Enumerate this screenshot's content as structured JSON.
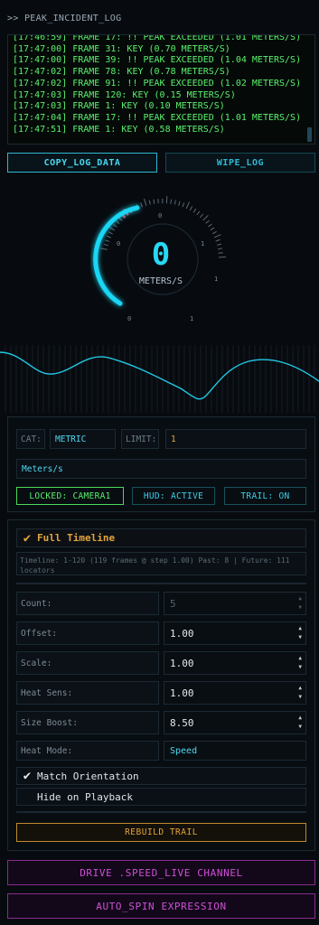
{
  "header": {
    "title": ">> PEAK_INCIDENT_LOG"
  },
  "log": {
    "lines": [
      "[17:46:59] FRAME 17: !! PEAK EXCEEDED (1.01 METERS/S)",
      "[17:47:00] FRAME 31: KEY (0.70 METERS/S)",
      "[17:47:00] FRAME 39: !! PEAK EXCEEDED (1.04 METERS/S)",
      "[17:47:02] FRAME 78: KEY (0.78 METERS/S)",
      "[17:47:02] FRAME 91: !! PEAK EXCEEDED (1.02 METERS/S)",
      "[17:47:03] FRAME 120: KEY (0.15 METERS/S)",
      "[17:47:03] FRAME 1: KEY (0.10 METERS/S)",
      "[17:47:04] FRAME 17: !! PEAK EXCEEDED (1.01 METERS/S)",
      "[17:47:51] FRAME 1: KEY (0.58 METERS/S)"
    ],
    "copy_label": "COPY_LOG_DATA",
    "wipe_label": "WIPE_LOG"
  },
  "gauge": {
    "value": "0",
    "unit": "METERS/S",
    "ticks": [
      "0",
      "0",
      "1",
      "1",
      "0",
      "1"
    ],
    "fill_fraction": 0.0,
    "colors": {
      "accent": "#1ad6f3",
      "peak": "#e0304a"
    }
  },
  "settings": {
    "cat_label": "CAT:",
    "cat_value": "METRIC",
    "limit_label": "LIMIT:",
    "limit_value": "1",
    "unit_value": "Meters/s",
    "locked": "LOCKED: CAMERA1",
    "hud": "HUD: ACTIVE",
    "trail": "TRAIL: ON"
  },
  "timeline": {
    "full_label": "Full Timeline",
    "full_checked": true,
    "info": "Timeline: 1-120  (119 frames @ step 1.00)  Past: 8 | Future: 111 locators",
    "rows": [
      {
        "label": "Count:",
        "value": "5",
        "disabled": true
      },
      {
        "label": "Offset:",
        "value": "1.00"
      },
      {
        "label": "Scale:",
        "value": "1.00"
      },
      {
        "label": "Heat Sens:",
        "value": "1.00"
      },
      {
        "label": "Size Boost:",
        "value": "8.50"
      }
    ],
    "heat_mode_label": "Heat Mode:",
    "heat_mode_value": "Speed",
    "match_orientation_label": "Match Orientation",
    "match_orientation_checked": true,
    "hide_playback_label": "Hide on Playback",
    "hide_playback_checked": false,
    "rebuild_label": "REBUILD TRAIL"
  },
  "actions": {
    "drive_label": "DRIVE .SPEED_LIVE CHANNEL",
    "autospin_label": "AUTO_SPIN EXPRESSION"
  }
}
